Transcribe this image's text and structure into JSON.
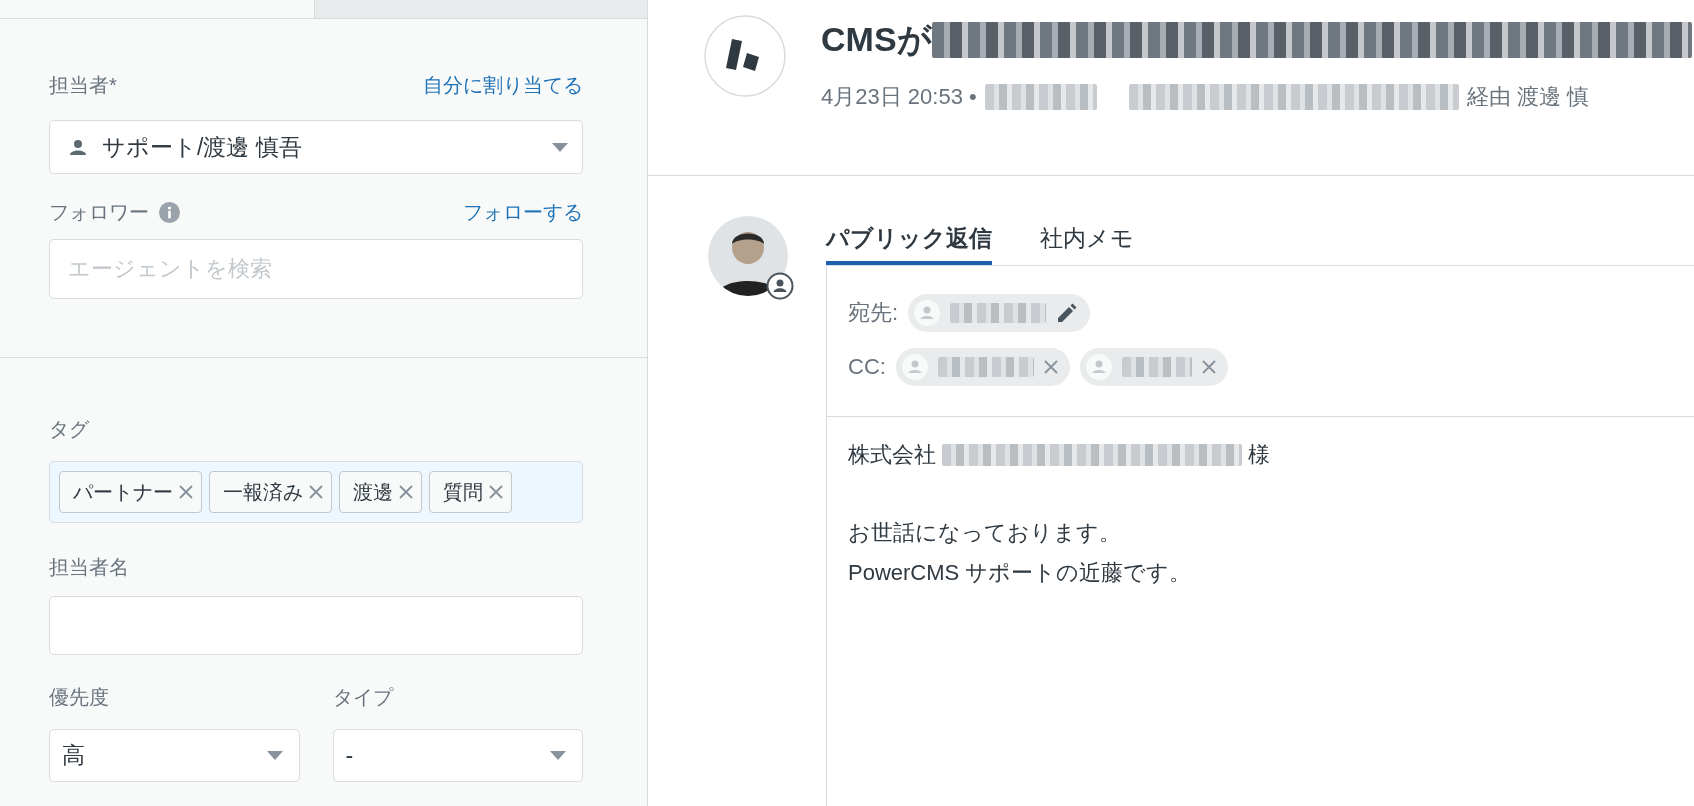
{
  "assignee": {
    "label": "担当者*",
    "action": "自分に割り当てる",
    "value": "サポート/渡邊 慎吾"
  },
  "followers": {
    "label": "フォロワー",
    "action": "フォローする",
    "placeholder": "エージェントを検索"
  },
  "tags": {
    "label": "タグ",
    "items": [
      "パートナー",
      "一報済み",
      "渡邊",
      "質問"
    ]
  },
  "assignee_name": {
    "label": "担当者名"
  },
  "priority": {
    "label": "優先度",
    "value": "高"
  },
  "type": {
    "label": "タイプ",
    "value": "-"
  },
  "ticket": {
    "title": "CMSが",
    "date": "4月23日 20:53 •",
    "via": "経由 渡邊 慎"
  },
  "reply_tabs": [
    {
      "label": "パブリック返信",
      "selected": true
    },
    {
      "label": "社内メモ",
      "selected": false
    }
  ],
  "recipients": {
    "to_label": "宛先:",
    "cc_label": "CC:"
  },
  "body": {
    "greeting_start": "株式会社",
    "greeting_end": "様",
    "lines": [
      "お世話になっております。",
      "PowerCMS サポートの近藤です。"
    ]
  }
}
